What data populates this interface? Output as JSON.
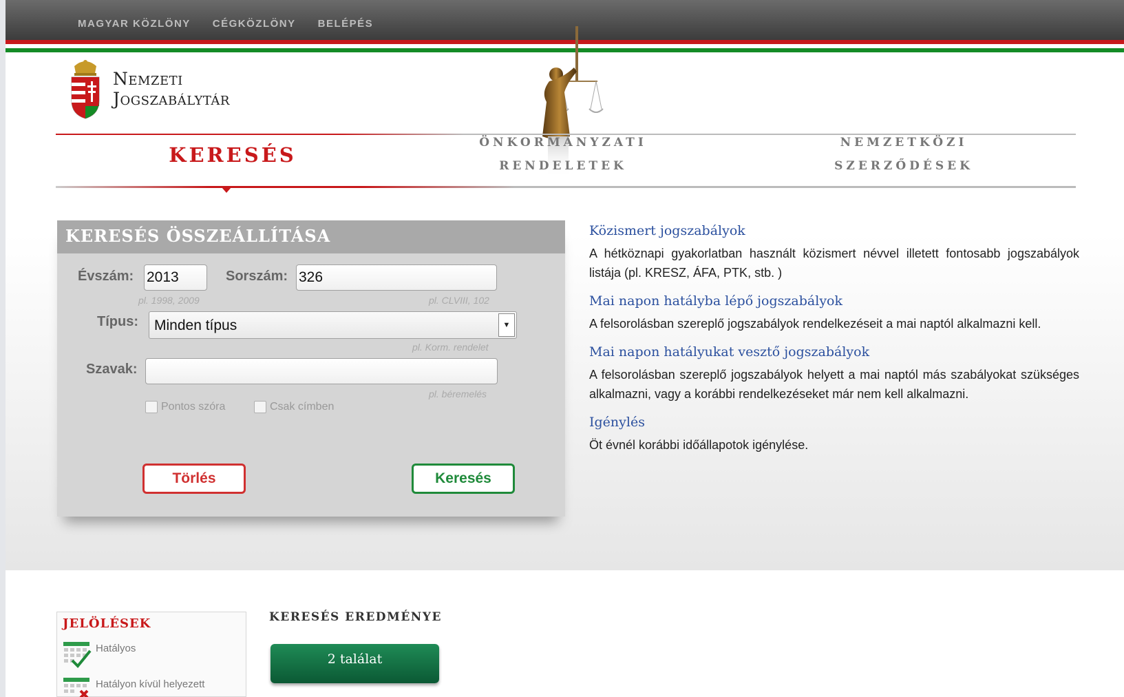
{
  "topbar": {
    "links": [
      "MAGYAR KÖZLÖNY",
      "CÉGKÖZLÖNY",
      "BELÉPÉS"
    ]
  },
  "logo": {
    "line1": "Nemzeti",
    "line2": "Jogszabálytár"
  },
  "nav": {
    "active": "KERESÉS",
    "item2_line1": "ÖNKORMÁNYZATI",
    "item2_line2": "RENDELETEK",
    "item3_line1": "NEMZETKÖZI",
    "item3_line2": "SZERZŐDÉSEK"
  },
  "search": {
    "title": "KERESÉS ÖSSZEÁLLÍTÁSA",
    "year_label": "Évszám:",
    "year_value": "2013",
    "year_hint": "pl. 1998, 2009",
    "number_label": "Sorszám:",
    "number_value": "326",
    "number_hint": "pl. CLVIII, 102",
    "type_label": "Típus:",
    "type_value": "Minden típus",
    "type_hint": "pl. Korm. rendelet",
    "words_label": "Szavak:",
    "words_value": "",
    "words_hint": "pl. béremelés",
    "exact_word_label": "Pontos szóra",
    "title_only_label": "Csak címben",
    "clear_label": "Törlés",
    "search_label": "Keresés"
  },
  "info": [
    {
      "title": "Közismert jogszabályok",
      "text": "A hétköznapi gyakorlatban használt közismert névvel illetett fontosabb jogszabályok listája (pl. KRESZ, ÁFA, PTK, stb. )"
    },
    {
      "title": "Mai napon hatályba lépő jogszabályok",
      "text": "A felsorolásban szereplő jogszabályok rendelkezéseit a mai naptól alkalmazni kell."
    },
    {
      "title": "Mai napon hatályukat vesztő jogszabályok",
      "text": "A felsorolásban szereplő jogszabályok helyett a mai naptól más szabályokat szükséges alkalmazni, vagy a korábbi rendelkezéseket már nem kell alkalmazni."
    },
    {
      "title": "Igénylés",
      "text": "Öt évnél korábbi időállapotok igénylése."
    }
  ],
  "legend": {
    "title": "JELÖLÉSEK",
    "items": [
      "Hatályos",
      "Hatályon kívül helyezett"
    ]
  },
  "results": {
    "title": "KERESÉS EREDMÉNYE",
    "count_label": "2 találat"
  },
  "colors": {
    "red": "#c8191b",
    "green": "#148b26",
    "link_blue": "#2a4f9e",
    "result_green": "#0b5934"
  }
}
